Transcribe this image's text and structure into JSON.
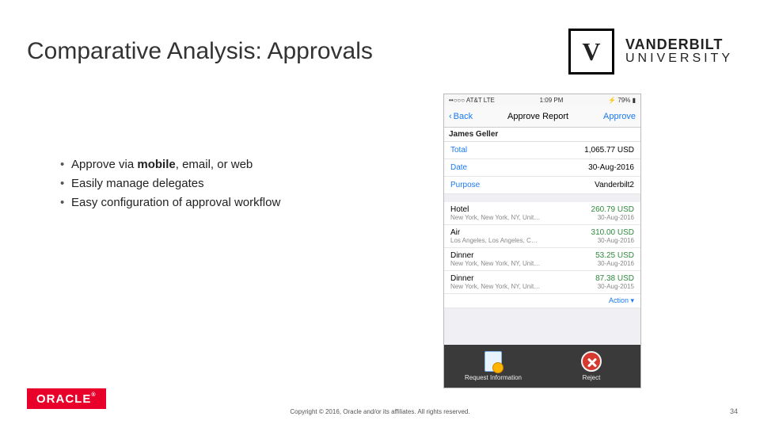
{
  "title": "Comparative Analysis: Approvals",
  "brand": {
    "mark_letter": "V",
    "line1": "VANDERBILT",
    "line2": "UNIVERSITY"
  },
  "bullets": [
    [
      {
        "text": "Approve via ",
        "bold": false
      },
      {
        "text": "mobile",
        "bold": true
      },
      {
        "text": ", email, or web",
        "bold": false
      }
    ],
    [
      {
        "text": "Easily manage delegates",
        "bold": false
      }
    ],
    [
      {
        "text": "Easy configuration of approval workflow",
        "bold": false
      }
    ]
  ],
  "phone": {
    "status": {
      "left": "••○○○ AT&T  LTE",
      "center": "1:09 PM",
      "right": "⚡ 79% ▮"
    },
    "nav": {
      "back": "Back",
      "title": "Approve Report",
      "action": "Approve"
    },
    "requester": "James Geller",
    "summary": [
      {
        "key": "Total",
        "value": "1,065.77 USD"
      },
      {
        "key": "Date",
        "value": "30-Aug-2016"
      },
      {
        "key": "Purpose",
        "value": "Vanderbilt2"
      }
    ],
    "lines": [
      {
        "category": "Hotel",
        "location": "New York, New York, NY, Unit…",
        "amount": "260.79 USD",
        "date": "30-Aug-2016"
      },
      {
        "category": "Air",
        "location": "Los Angeles, Los Angeles, C…",
        "amount": "310.00 USD",
        "date": "30-Aug-2016"
      },
      {
        "category": "Dinner",
        "location": "New York, New York, NY, Unit…",
        "amount": "53.25 USD",
        "date": "30-Aug-2016"
      },
      {
        "category": "Dinner",
        "location": "New York, New York, NY, Unit…",
        "amount": "87.38 USD",
        "date": "30-Aug-2015"
      }
    ],
    "row_action": "Action ▾",
    "toolbar": {
      "left": "Request Information",
      "right": "Reject"
    }
  },
  "footer": {
    "oracle": "ORACLE",
    "copyright": "Copyright © 2016, Oracle and/or its affiliates. All rights reserved.",
    "page": "34"
  }
}
